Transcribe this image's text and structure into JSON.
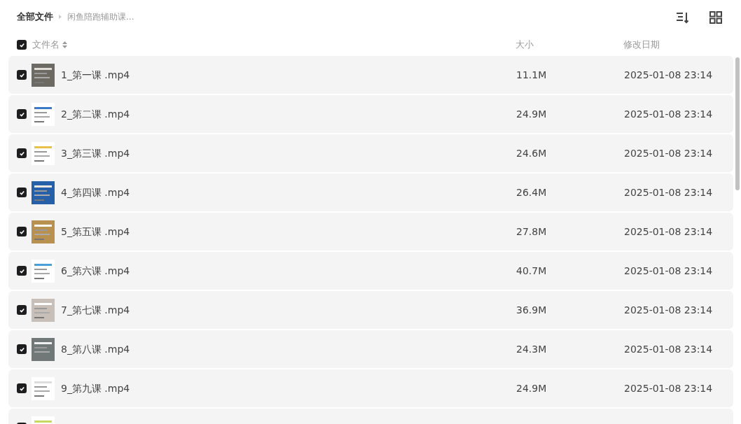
{
  "breadcrumb": [
    {
      "label": "全部文件",
      "current": false
    },
    {
      "label": "闲鱼陪跑辅助课...",
      "current": true
    }
  ],
  "table": {
    "select_all_checked": true,
    "columns": [
      {
        "label": "文件名",
        "sortable": true
      },
      {
        "label": "大小",
        "sortable": false
      },
      {
        "label": "修改日期",
        "sortable": false
      }
    ],
    "rows": [
      {
        "checked": true,
        "name": "1_第一课 .mp4",
        "size": "11.1M",
        "date": "2025-01-08 23:14"
      },
      {
        "checked": true,
        "name": "2_第二课 .mp4",
        "size": "24.9M",
        "date": "2025-01-08 23:14"
      },
      {
        "checked": true,
        "name": "3_第三课 .mp4",
        "size": "24.6M",
        "date": "2025-01-08 23:14"
      },
      {
        "checked": true,
        "name": "4_第四课 .mp4",
        "size": "26.4M",
        "date": "2025-01-08 23:14"
      },
      {
        "checked": true,
        "name": "5_第五课 .mp4",
        "size": "27.8M",
        "date": "2025-01-08 23:14"
      },
      {
        "checked": true,
        "name": "6_第六课 .mp4",
        "size": "40.7M",
        "date": "2025-01-08 23:14"
      },
      {
        "checked": true,
        "name": "7_第七课 .mp4",
        "size": "36.9M",
        "date": "2025-01-08 23:14"
      },
      {
        "checked": true,
        "name": "8_第八课 .mp4",
        "size": "24.3M",
        "date": "2025-01-08 23:14"
      },
      {
        "checked": true,
        "name": "9_第九课 .mp4",
        "size": "24.9M",
        "date": "2025-01-08 23:14"
      },
      {
        "checked": true
      }
    ]
  }
}
